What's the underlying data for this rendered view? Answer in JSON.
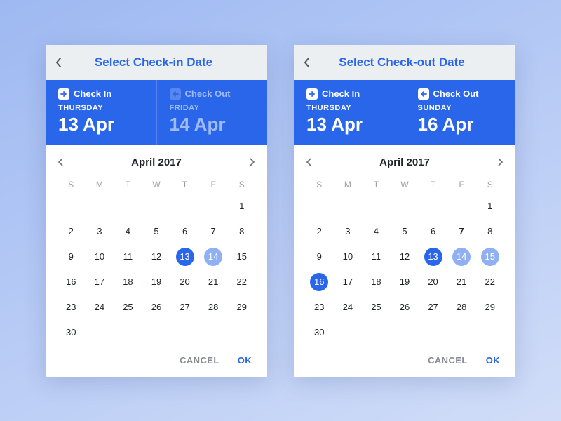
{
  "weekdays": [
    "S",
    "M",
    "T",
    "W",
    "T",
    "F",
    "S"
  ],
  "panels": [
    {
      "title": "Select Check-in Date",
      "checkin": {
        "label": "Check In",
        "dow": "THURSDAY",
        "date": "13 Apr",
        "dim": false
      },
      "checkout": {
        "label": "Check Out",
        "dow": "FRIDAY",
        "date": "14 Apr",
        "dim": true
      },
      "month": "April 2017",
      "firstDayOffset": 6,
      "lastDay": 30,
      "selected": [
        13
      ],
      "range": [
        14
      ],
      "bold": [],
      "actions": {
        "cancel": "CANCEL",
        "ok": "OK"
      }
    },
    {
      "title": "Select Check-out Date",
      "checkin": {
        "label": "Check In",
        "dow": "THURSDAY",
        "date": "13 Apr",
        "dim": false
      },
      "checkout": {
        "label": "Check Out",
        "dow": "SUNDAY",
        "date": "16 Apr",
        "dim": false
      },
      "month": "April 2017",
      "firstDayOffset": 6,
      "lastDay": 30,
      "selected": [
        13,
        16
      ],
      "range": [
        14,
        15
      ],
      "bold": [
        7
      ],
      "actions": {
        "cancel": "CANCEL",
        "ok": "OK"
      }
    }
  ]
}
